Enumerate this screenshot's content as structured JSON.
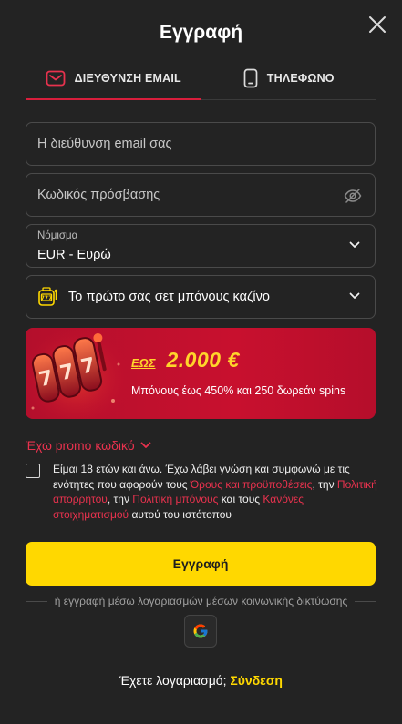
{
  "header": {
    "title": "Εγγραφή",
    "close_icon": "close-icon"
  },
  "tabs": [
    {
      "label": "ΔΙΕΥΘΥΝΣΗ EMAIL",
      "icon": "mail-icon",
      "active": true
    },
    {
      "label": "ΤΗΛΕΦΩΝΟ",
      "icon": "phone-icon",
      "active": false
    }
  ],
  "form": {
    "email_placeholder": "Η διεύθυνση email σας",
    "password_placeholder": "Κωδικός πρόσβασης",
    "currency_label": "Νόμισμα",
    "currency_value": "EUR - Ευρώ",
    "bonus_value": "Το πρώτο σας σετ μπόνους καζίνο"
  },
  "banner": {
    "prefix": "ΕΩΣ",
    "amount": "2.000 €",
    "subtitle": "Μπόνους έως 450% και 250 δωρεάν spins"
  },
  "promo": {
    "label": "Έχω promo κωδικό"
  },
  "terms": {
    "t1": "Είμαι 18 ετών και άνω. Έχω λάβει γνώση και συμφωνώ με τις ενότητες που αφορούν τους ",
    "l1": "Όρους και προϋποθέσεις",
    "t2": ", την ",
    "l2": "Πολιτική απορρήτου",
    "t3": ", την ",
    "l3": "Πολιτική μπόνους",
    "t4": " και τους ",
    "l4": "Κανόνες στοιχηματισμού",
    "t5": " αυτού του ιστότοπου"
  },
  "submit": {
    "label": "Εγγραφή"
  },
  "social": {
    "divider_text": "ή εγγραφή μέσω λογαριασμών μέσων κοινωνικής δικτύωσης",
    "icon": "google-icon"
  },
  "footer": {
    "question": "Έχετε λογαριασμό;",
    "login_link": "Σύνδεση"
  },
  "colors": {
    "background": "#232323",
    "accent_red": "#d81e3c",
    "accent_yellow": "#ffd800",
    "banner_red": "#c8102e"
  }
}
